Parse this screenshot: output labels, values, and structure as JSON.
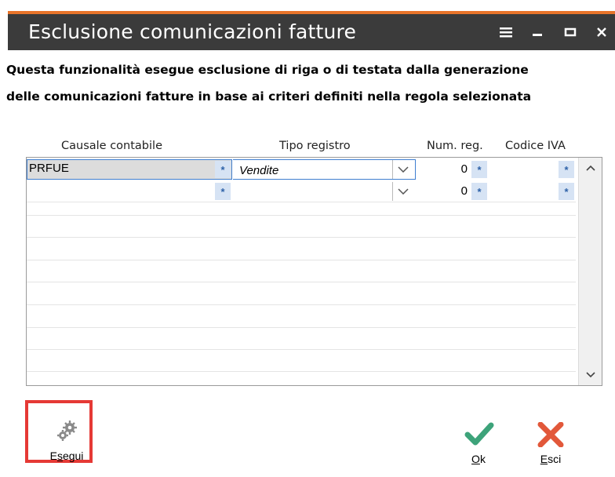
{
  "window": {
    "title": "Esclusione comunicazioni fatture",
    "accent_color": "#e8742a",
    "titlebar_color": "#3b3b3b",
    "controls": [
      "menu-icon",
      "minimize-icon",
      "maximize-icon",
      "close-icon"
    ]
  },
  "description": {
    "line1": "Questa funzionalità esegue esclusione di riga o di testata dalla generazione",
    "line2": "delle comunicazioni fatture in base ai criteri definiti nella regola selezionata"
  },
  "grid": {
    "columns": {
      "causale": "Causale contabile",
      "tipo": "Tipo registro",
      "num": "Num. reg.",
      "iva": "Codice IVA"
    },
    "rows": [
      {
        "causale": "PRFUE",
        "tipo": "Vendite",
        "num": "0",
        "iva": ""
      },
      {
        "causale": "",
        "tipo": "",
        "num": "0",
        "iva": ""
      }
    ],
    "zoom_symbol": "*"
  },
  "actions": {
    "esegui": {
      "first": "E",
      "underlined": "s",
      "rest": "egui"
    },
    "ok": {
      "first": "",
      "underlined": "O",
      "rest": "k"
    },
    "esci": {
      "first": "",
      "underlined": "E",
      "rest": "sci"
    }
  },
  "colors": {
    "highlight_border": "#e53935",
    "ok_check": "#3da37a",
    "esci_x": "#e2583a",
    "selection_border": "#3f7fd0"
  }
}
